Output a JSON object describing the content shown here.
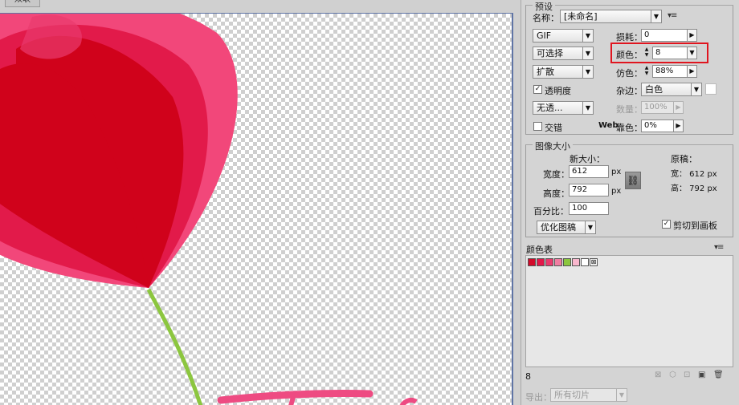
{
  "document": {
    "tab_label": "双联"
  },
  "preset": {
    "group_title": "预设",
    "name_label": "名称：",
    "name_value": "[未命名]",
    "format_value": "GIF",
    "reduction_value": "可选择",
    "dither_algo_value": "扩散",
    "transparency_label": "透明度",
    "transparency_checked": true,
    "trans_dither_value": "无透...",
    "interlace_label": "交错",
    "interlace_checked": false,
    "lossy_label": "损耗：",
    "lossy_value": "0",
    "colors_label": "颜色：",
    "colors_value": "8",
    "dither_label": "仿色：",
    "dither_value": "88%",
    "matte_label": "杂边：",
    "matte_value": "白色",
    "amount_label": "数量：",
    "amount_value": "100%",
    "web_snap_label_a": "Web",
    "web_snap_label_b": "靠色：",
    "web_snap_value": "0%"
  },
  "image_size": {
    "group_title": "图像大小",
    "new_size_label": "新大小：",
    "width_label": "宽度：",
    "width_value": "612",
    "height_label": "高度：",
    "height_value": "792",
    "percent_label": "百分比：",
    "percent_value": "100",
    "unit_w": "px",
    "unit_h": "px",
    "original_label": "原稿：",
    "orig_width_text": "宽： 612 px",
    "orig_height_text": "高： 792 px",
    "quality_value": "优化图稿",
    "clip_label": "剪切到画板",
    "clip_checked": true
  },
  "color_table": {
    "title": "颜色表",
    "count": "8",
    "swatches": [
      "#d10a2a",
      "#e3174a",
      "#ea3a6e",
      "#f07ea2",
      "#8cc63f",
      "#f9b7cd",
      "#ffffff",
      "transparent"
    ]
  },
  "export": {
    "label": "导出：",
    "value": "所有切片"
  },
  "icons": {
    "menu": "panel-menu-icon",
    "link": "link-chain-icon",
    "dropdown": "dropdown-arrow-icon"
  },
  "colors": {
    "highlight": "#e0151f",
    "tulip_outer": "#f2477a",
    "tulip_mid": "#e21a4a",
    "tulip_inner": "#d0021b",
    "stem": "#8cc63f",
    "text_stroke": "#ee4b82"
  }
}
